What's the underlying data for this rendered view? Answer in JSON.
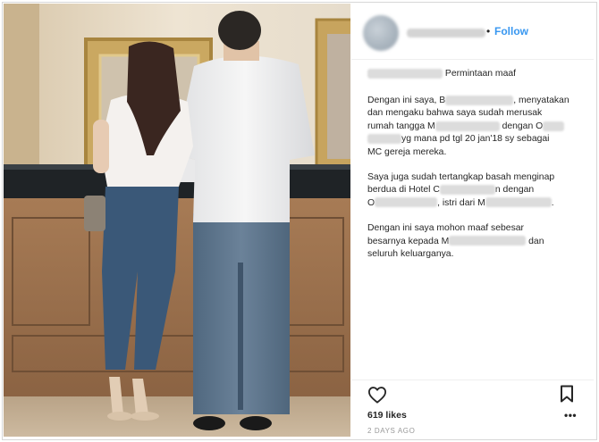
{
  "post": {
    "follow_label": "Follow",
    "separator": "•",
    "likes": "619 likes",
    "timestamp": "2 DAYS AGO"
  },
  "caption": {
    "title": "Permintaan maaf",
    "p1": {
      "l1a": "Dengan ini saya, B",
      "l1b": ", menyatakan",
      "l2": "dan mengaku bahwa saya sudah merusak",
      "l3a": "rumah tangga M",
      "l3b": "dengan O",
      "l4": "yg mana pd tgl 20 jan'18 sy sebagai",
      "l5": "MC gereja mereka."
    },
    "p2": {
      "l1": "Saya juga sudah tertangkap basah menginap",
      "l2a": "berdua di Hotel C",
      "l2b": "n dengan",
      "l3a": "O",
      "l3b": ", istri dari M",
      "l3c": "."
    },
    "p3": {
      "l1": "Dengan ini saya mohon maaf sebesar",
      "l2a": "besarnya kepada M",
      "l2b": "dan",
      "l3": "seluruh keluarganya."
    }
  },
  "icons": {
    "heart": "heart-icon",
    "bookmark": "bookmark-icon",
    "more": "more-options-icon"
  }
}
